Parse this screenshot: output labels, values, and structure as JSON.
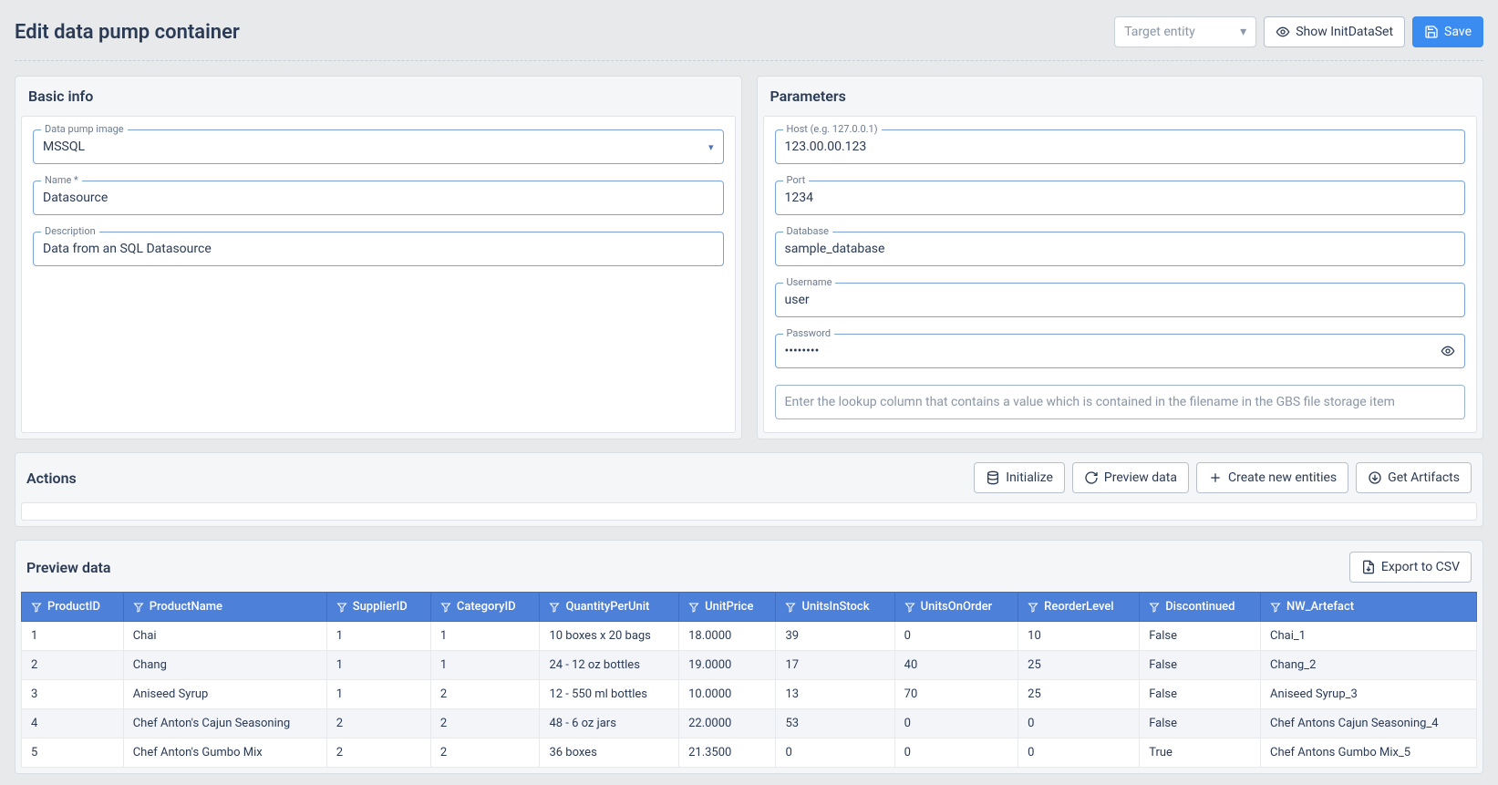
{
  "header": {
    "title": "Edit data pump container",
    "target_entity_placeholder": "Target entity",
    "show_init_label": "Show InitDataSet",
    "save_label": "Save"
  },
  "basic_info": {
    "title": "Basic info",
    "image_label": "Data pump image",
    "image_value": "MSSQL",
    "name_label": "Name *",
    "name_value": "Datasource",
    "description_label": "Description",
    "description_value": "Data from an SQL Datasource"
  },
  "parameters": {
    "title": "Parameters",
    "host_label": "Host (e.g. 127.0.0.1)",
    "host_value": "123.00.00.123",
    "port_label": "Port",
    "port_value": "1234",
    "database_label": "Database",
    "database_value": "sample_database",
    "username_label": "Username",
    "username_value": "user",
    "password_label": "Password",
    "password_value": "••••••••",
    "lookup_placeholder": "Enter the lookup column that contains a value which is contained in the filename in the GBS file storage item"
  },
  "actions": {
    "title": "Actions",
    "initialize_label": "Initialize",
    "preview_data_label": "Preview data",
    "create_entities_label": "Create new entities",
    "get_artifacts_label": "Get Artifacts"
  },
  "preview": {
    "title": "Preview data",
    "export_label": "Export to CSV",
    "columns": [
      "ProductID",
      "ProductName",
      "SupplierID",
      "CategoryID",
      "QuantityPerUnit",
      "UnitPrice",
      "UnitsInStock",
      "UnitsOnOrder",
      "ReorderLevel",
      "Discontinued",
      "NW_Artefact"
    ],
    "rows": [
      [
        "1",
        "Chai",
        "1",
        "1",
        "10 boxes x 20 bags",
        "18.0000",
        "39",
        "0",
        "10",
        "False",
        "Chai_1"
      ],
      [
        "2",
        "Chang",
        "1",
        "1",
        "24 - 12 oz bottles",
        "19.0000",
        "17",
        "40",
        "25",
        "False",
        "Chang_2"
      ],
      [
        "3",
        "Aniseed Syrup",
        "1",
        "2",
        "12 - 550 ml bottles",
        "10.0000",
        "13",
        "70",
        "25",
        "False",
        "Aniseed Syrup_3"
      ],
      [
        "4",
        "Chef Anton's Cajun Seasoning",
        "2",
        "2",
        "48 - 6 oz jars",
        "22.0000",
        "53",
        "0",
        "0",
        "False",
        "Chef Antons Cajun Seasoning_4"
      ],
      [
        "5",
        "Chef Anton's Gumbo Mix",
        "2",
        "2",
        "36 boxes",
        "21.3500",
        "0",
        "0",
        "0",
        "True",
        "Chef Antons Gumbo Mix_5"
      ]
    ]
  }
}
